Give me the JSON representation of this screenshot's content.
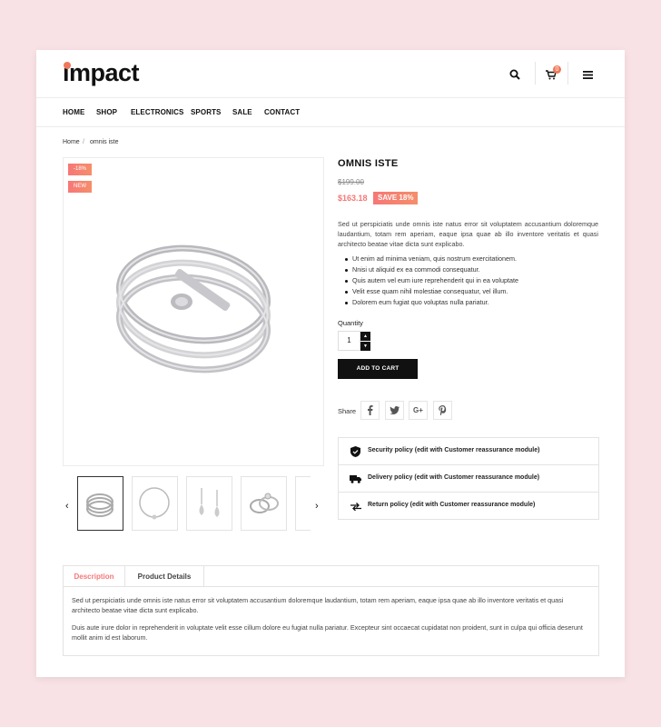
{
  "brand": {
    "logo": "impact",
    "accent": "#f0785a"
  },
  "header": {
    "cart_count": "0"
  },
  "nav": [
    "HOME",
    "SHOP",
    "ELECTRONICS",
    "SPORTS",
    "SALE",
    "CONTACT"
  ],
  "breadcrumb": {
    "home": "Home",
    "sep": "/",
    "current": "omnis iste"
  },
  "gallery": {
    "flags": [
      "-18%",
      "NEW"
    ],
    "prev": "‹",
    "next": "›"
  },
  "product": {
    "title": "OMNIS ISTE",
    "old_price": "$199.00",
    "price": "$163.18",
    "save": "SAVE 18%",
    "description": "Sed ut perspiciatis unde omnis iste natus error sit voluptatem accusantium doloremque laudantium, totam rem aperiam, eaque ipsa quae ab illo inventore veritatis et quasi architecto beatae vitae dicta sunt explicabo.",
    "bullets": [
      "Ut enim ad minima veniam, quis nostrum exercitationem.",
      "Nnisi ut aliquid ex ea commodi consequatur.",
      "Quis autem vel eum iure reprehenderit qui in ea voluptate",
      "Velit esse quam nihil molestiae consequatur, vel illum.",
      "Dolorem eum fugiat quo voluptas nulla pariatur."
    ],
    "quantity_label": "Quantity",
    "quantity_value": "1",
    "add_to_cart": "ADD TO CART",
    "share_label": "Share"
  },
  "reassurance": [
    "Security policy (edit with Customer reassurance module)",
    "Delivery policy (edit with Customer reassurance module)",
    "Return policy (edit with Customer reassurance module)"
  ],
  "tabs": {
    "labels": [
      "Description",
      "Product Details"
    ],
    "p1": "Sed ut perspiciatis unde omnis iste natus error sit voluptatem accusantium doloremque laudantium, totam rem aperiam, eaque ipsa quae ab illo inventore veritatis et quasi architecto beatae vitae dicta sunt explicabo.",
    "p2": "Duis aute irure dolor in reprehenderit in voluptate velit esse cillum dolore eu fugiat nulla pariatur. Excepteur sint occaecat cupidatat non proident, sunt in culpa qui officia deserunt mollit anim id est laborum."
  },
  "colors": {
    "sale": "#f67777",
    "dark": "#111111",
    "background": "#f9e2e6"
  }
}
